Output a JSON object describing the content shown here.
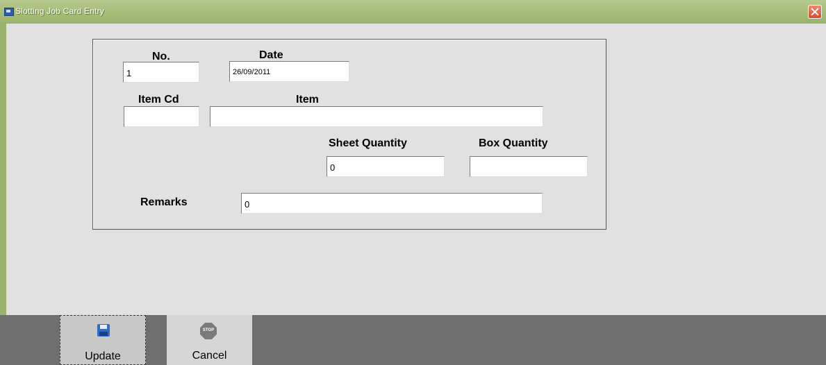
{
  "window": {
    "title": "Slotting Job Card Entry"
  },
  "form": {
    "no": {
      "label": "No.",
      "value": "1"
    },
    "date": {
      "label": "Date",
      "value": "26/09/2011"
    },
    "item_cd": {
      "label": "Item Cd",
      "value": ""
    },
    "item": {
      "label": "Item",
      "value": ""
    },
    "sheet_quantity": {
      "label": "Sheet Quantity",
      "value": "0"
    },
    "box_quantity": {
      "label": "Box Quantity",
      "value": ""
    },
    "remarks": {
      "label": "Remarks",
      "value": "0"
    }
  },
  "toolbar": {
    "update_label": "Update",
    "cancel_label": "Cancel",
    "stop_icon_text": "STOP"
  },
  "icons": {
    "app": "app-window-icon",
    "close": "close-icon",
    "update": "floppy-disk-icon",
    "cancel": "stop-sign-icon"
  },
  "colors": {
    "titlebar": "#a6bd78",
    "close": "#d9482a",
    "toolbar": "#6f6f6f",
    "update_icon": "#2f6cc6"
  }
}
